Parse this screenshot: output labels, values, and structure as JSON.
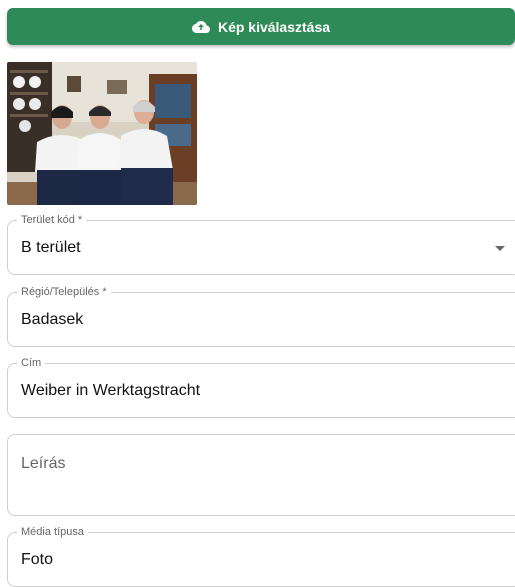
{
  "upload": {
    "label": "Kép kiválasztása",
    "icon": "cloud-upload-icon",
    "color": "#2e8b57"
  },
  "form": {
    "area_code": {
      "label": "Terület kód *",
      "value": "B terület"
    },
    "region": {
      "label": "Régió/Település *",
      "value": "Badasek"
    },
    "title": {
      "label": "Cím",
      "value": "Weiber in Werktagstracht"
    },
    "description": {
      "placeholder": "Leírás"
    },
    "media_type": {
      "label": "Média típusa",
      "value": "Foto"
    }
  }
}
